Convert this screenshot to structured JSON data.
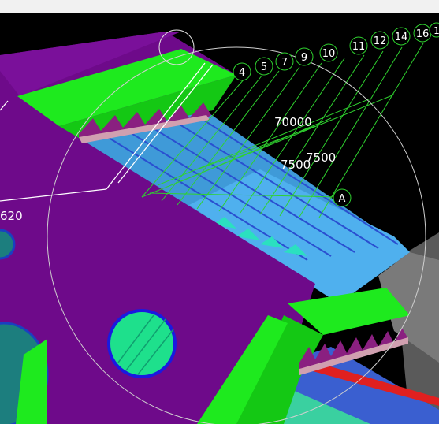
{
  "grid_labels": [
    "4",
    "5",
    "7",
    "9",
    "10",
    "11",
    "12",
    "14",
    "16",
    "1"
  ],
  "grid_label_A": "A",
  "dimension_labels": {
    "d1": "70000",
    "d2": "7500",
    "d3": "7500",
    "d4": "620"
  },
  "colors": {
    "background": "#000000",
    "plate": "#6e0a8a",
    "green": "#1eea1e",
    "blue_steel": "#4aa0e6",
    "teal": "#1c7e7e",
    "grid_line": "#2fd22f"
  }
}
